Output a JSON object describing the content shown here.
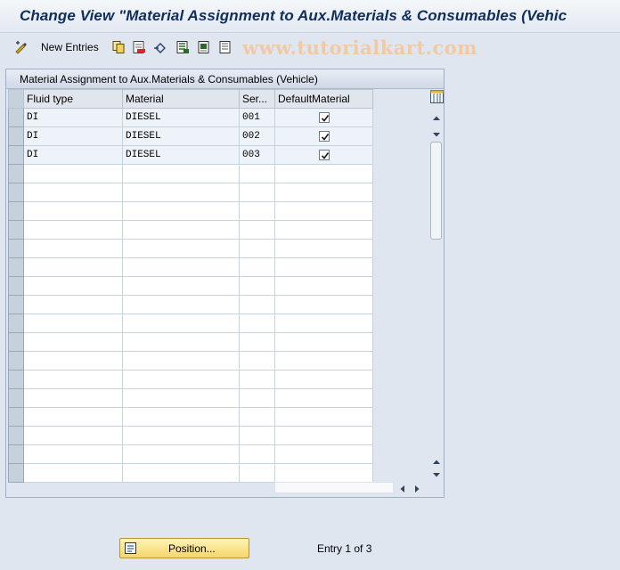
{
  "window": {
    "title": "Change View \"Material Assignment to Aux.Materials & Consumables (Vehic"
  },
  "toolbar": {
    "new_entries_label": "New Entries",
    "icons": [
      "display-change-icon",
      "copy-icon",
      "delete-icon",
      "undo-icon",
      "select-all-icon",
      "select-block-icon",
      "deselect-all-icon"
    ]
  },
  "watermark": "www.tutorialkart.com",
  "table": {
    "title": "Material Assignment to Aux.Materials & Consumables (Vehicle)",
    "columns": [
      "Fluid type",
      "Material",
      "Ser...",
      "DefaultMaterial"
    ],
    "rows": [
      {
        "fluid_type": "DI",
        "material": "DIESEL",
        "seq": "001",
        "default": true
      },
      {
        "fluid_type": "DI",
        "material": "DIESEL",
        "seq": "002",
        "default": true
      },
      {
        "fluid_type": "DI",
        "material": "DIESEL",
        "seq": "003",
        "default": true
      }
    ],
    "empty_row_count": 17
  },
  "footer": {
    "position_label": "Position...",
    "entry_info": "Entry 1 of 3"
  },
  "colors": {
    "title_text": "#0e2e5c",
    "background": "#dfe6ef",
    "button_yellow": "#f5d66a",
    "watermark": "#f2c9a2"
  }
}
